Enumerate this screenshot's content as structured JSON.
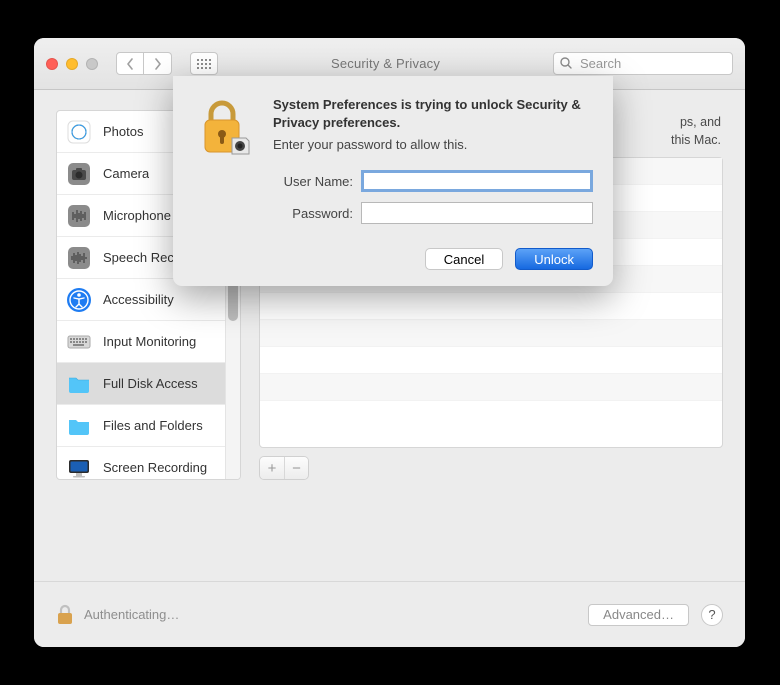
{
  "window": {
    "title": "Security & Privacy",
    "search_placeholder": "Search"
  },
  "sidebar": {
    "items": [
      {
        "label": "Photos"
      },
      {
        "label": "Camera"
      },
      {
        "label": "Microphone"
      },
      {
        "label": "Speech Recognition"
      },
      {
        "label": "Accessibility"
      },
      {
        "label": "Input Monitoring"
      },
      {
        "label": "Full Disk Access"
      },
      {
        "label": "Files and Folders"
      },
      {
        "label": "Screen Recording"
      }
    ]
  },
  "detail": {
    "header_fragment": "ps, and\nthis Mac.",
    "plus": "+",
    "minus": "−"
  },
  "footer": {
    "status": "Authenticating…",
    "advanced": "Advanced…",
    "help": "?"
  },
  "dialog": {
    "title": "System Preferences is trying to unlock Security & Privacy preferences.",
    "subtitle": "Enter your password to allow this.",
    "username_label": "User Name:",
    "password_label": "Password:",
    "username_value": "",
    "password_value": "",
    "cancel": "Cancel",
    "unlock": "Unlock"
  }
}
